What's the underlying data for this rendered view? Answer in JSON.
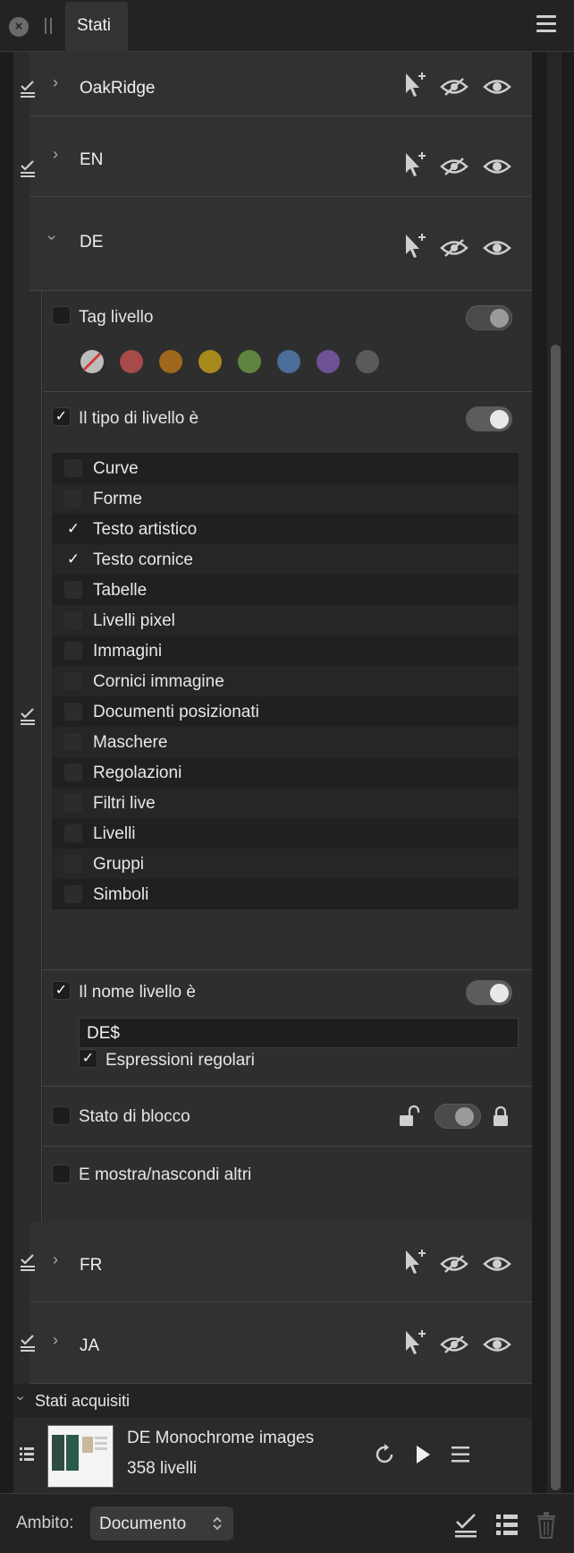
{
  "window": {
    "tab_title": "Stati",
    "close_symbol": "×"
  },
  "states": [
    {
      "name": "OakRidge",
      "expanded": false
    },
    {
      "name": "EN",
      "expanded": false
    },
    {
      "name": "DE",
      "expanded": true
    },
    {
      "name": "FR",
      "expanded": false
    },
    {
      "name": "JA",
      "expanded": false
    }
  ],
  "de_panel": {
    "tag": {
      "label": "Tag livello",
      "checked": false,
      "toggle_on": false,
      "colors": [
        "none",
        "#a64a4a",
        "#a0671c",
        "#a8891e",
        "#5f8440",
        "#4a6d9a",
        "#6e5296",
        "#5a5a5a"
      ]
    },
    "type": {
      "label": "Il tipo di livello è",
      "checked": true,
      "toggle_on": true
    },
    "types": [
      {
        "label": "Curve",
        "checked": false
      },
      {
        "label": "Forme",
        "checked": false
      },
      {
        "label": "Testo artistico",
        "checked": true
      },
      {
        "label": "Testo cornice",
        "checked": true
      },
      {
        "label": "Tabelle",
        "checked": false
      },
      {
        "label": "Livelli pixel",
        "checked": false
      },
      {
        "label": "Immagini",
        "checked": false
      },
      {
        "label": "Cornici immagine",
        "checked": false
      },
      {
        "label": "Documenti posizionati",
        "checked": false
      },
      {
        "label": "Maschere",
        "checked": false
      },
      {
        "label": "Regolazioni",
        "checked": false
      },
      {
        "label": "Filtri live",
        "checked": false
      },
      {
        "label": "Livelli",
        "checked": false
      },
      {
        "label": "Gruppi",
        "checked": false
      },
      {
        "label": "Simboli",
        "checked": false
      }
    ],
    "name": {
      "label": "Il nome livello è",
      "checked": true,
      "toggle_on": true,
      "value": "DE$",
      "regex_label": "Espressioni regolari",
      "regex_checked": true
    },
    "lock": {
      "label": "Stato di blocco",
      "checked": false
    },
    "others": {
      "label": "E mostra/nascondi altri",
      "checked": false
    }
  },
  "acquired": {
    "header": "Stati acquisiti",
    "item": {
      "title": "DE Monochrome images",
      "subtitle": "358 livelli"
    }
  },
  "bottom": {
    "scope_label": "Ambito:",
    "scope_value": "Documento"
  },
  "checkmark": "✓"
}
